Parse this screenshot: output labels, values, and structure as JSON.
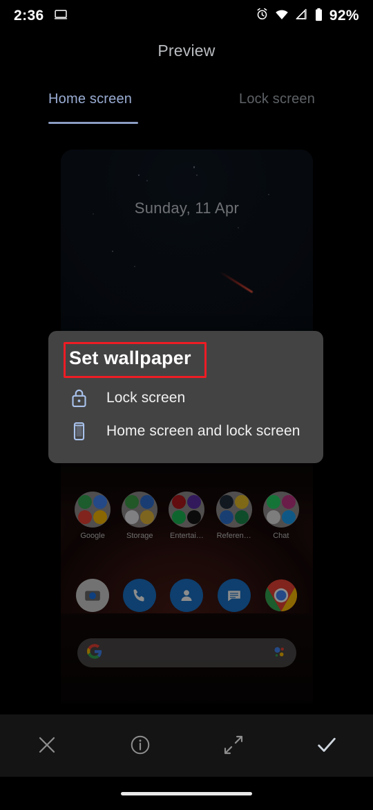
{
  "status_bar": {
    "time": "2:36",
    "left_icons": [
      "screen-cast-icon"
    ],
    "right_icons": [
      "alarm-icon",
      "wifi-icon",
      "mobile-data-off-icon",
      "battery-icon"
    ],
    "battery_percent": "92%"
  },
  "header": {
    "title": "Preview"
  },
  "tabs": [
    {
      "label": "Home screen",
      "active": true
    },
    {
      "label": "Lock screen",
      "active": false
    }
  ],
  "preview": {
    "date_text": "Sunday, 11 Apr",
    "folders": [
      {
        "label": "Google"
      },
      {
        "label": "Storage"
      },
      {
        "label": "Entertai…"
      },
      {
        "label": "Referen…"
      },
      {
        "label": "Chat"
      }
    ],
    "dock": [
      {
        "name": "camera-app-icon"
      },
      {
        "name": "phone-app-icon"
      },
      {
        "name": "contacts-app-icon"
      },
      {
        "name": "messages-app-icon"
      },
      {
        "name": "chrome-app-icon"
      }
    ],
    "search_bar": {
      "left_icon": "google-g-icon",
      "right_icon": "google-assistant-icon",
      "value": ""
    }
  },
  "dialog": {
    "title": "Set wallpaper",
    "highlight_color": "#ee1c24",
    "background_color": "#434343",
    "items": [
      {
        "label": "Lock screen",
        "icon": "lock-icon"
      },
      {
        "label": "Home screen and lock screen",
        "icon": "smartphone-icon"
      }
    ]
  },
  "toolbar": {
    "buttons": [
      {
        "name": "close-icon",
        "label": "Close"
      },
      {
        "name": "info-icon",
        "label": "Info"
      },
      {
        "name": "expand-icon",
        "label": "Full preview"
      },
      {
        "name": "confirm-check-icon",
        "label": "Apply"
      }
    ]
  },
  "nav_bar": {
    "gesture_pill": "home-gesture-pill"
  },
  "colors": {
    "accent_blue": "#9aadd4",
    "icon_blue": "#a9c2ec",
    "annotation_red": "#ee1c24"
  }
}
